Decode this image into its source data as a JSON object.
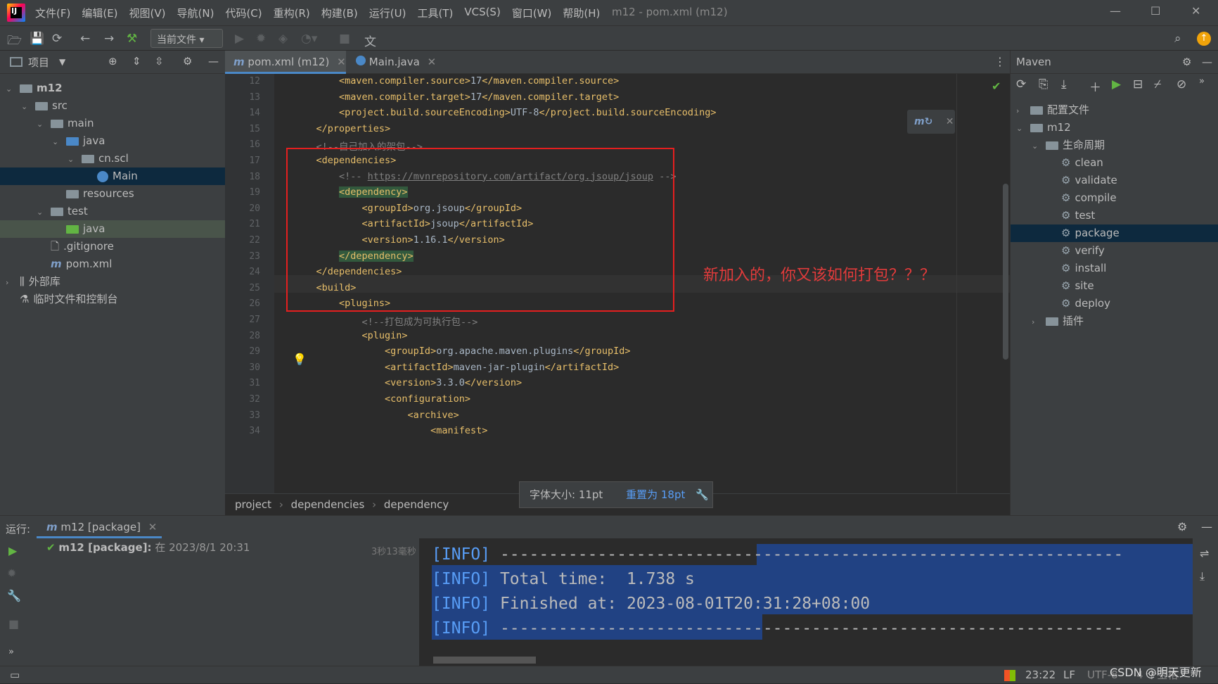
{
  "menubar": {
    "items": [
      "文件(F)",
      "编辑(E)",
      "视图(V)",
      "导航(N)",
      "代码(C)",
      "重构(R)",
      "构建(B)",
      "运行(U)",
      "工具(T)",
      "VCS(S)",
      "窗口(W)",
      "帮助(H)"
    ],
    "title": "m12 - pom.xml (m12)"
  },
  "toolbar": {
    "run_config": "当前文件"
  },
  "project": {
    "header": "项目",
    "tree": [
      {
        "label": "m12",
        "depth": 0,
        "kind": "module",
        "chev": "open"
      },
      {
        "label": "src",
        "depth": 1,
        "kind": "folder",
        "chev": "open"
      },
      {
        "label": "main",
        "depth": 2,
        "kind": "folder",
        "chev": "open"
      },
      {
        "label": "java",
        "depth": 3,
        "kind": "folder-blue",
        "chev": "open"
      },
      {
        "label": "cn.scl",
        "depth": 4,
        "kind": "package",
        "chev": "open"
      },
      {
        "label": "Main",
        "depth": 5,
        "kind": "class",
        "chev": "",
        "selected": true
      },
      {
        "label": "resources",
        "depth": 3,
        "kind": "folder",
        "chev": ""
      },
      {
        "label": "test",
        "depth": 2,
        "kind": "folder",
        "chev": "open"
      },
      {
        "label": "java",
        "depth": 3,
        "kind": "folder-green",
        "chev": "",
        "highlight": true
      },
      {
        "label": ".gitignore",
        "depth": 2,
        "kind": "file",
        "chev": ""
      },
      {
        "label": "pom.xml",
        "depth": 2,
        "kind": "maven",
        "chev": ""
      },
      {
        "label": "外部库",
        "depth": 0,
        "kind": "lib",
        "chev": "closed"
      },
      {
        "label": "临时文件和控制台",
        "depth": 0,
        "kind": "scratch",
        "chev": ""
      }
    ]
  },
  "tabs": [
    {
      "label": "pom.xml (m12)",
      "active": true
    },
    {
      "label": "Main.java",
      "active": false
    }
  ],
  "editor": {
    "lines": [
      {
        "n": "12",
        "code": "        <maven.compiler.source>17</maven.compiler.source>"
      },
      {
        "n": "13",
        "code": "        <maven.compiler.target>17</maven.compiler.target>"
      },
      {
        "n": "14",
        "code": "        <project.build.sourceEncoding>UTF-8</project.build.sourceEncoding>"
      },
      {
        "n": "15",
        "code": "    </properties>"
      },
      {
        "n": "16",
        "code": "    <!--自己加入的架包-->"
      },
      {
        "n": "17",
        "code": "    <dependencies>"
      },
      {
        "n": "18",
        "code": "        <!-- https://mvnrepository.com/artifact/org.jsoup/jsoup -->"
      },
      {
        "n": "19",
        "code": "        <dependency>"
      },
      {
        "n": "20",
        "code": "            <groupId>org.jsoup</groupId>"
      },
      {
        "n": "21",
        "code": "            <artifactId>jsoup</artifactId>"
      },
      {
        "n": "22",
        "code": "            <version>1.16.1</version>"
      },
      {
        "n": "23",
        "code": "        </dependency>"
      },
      {
        "n": "24",
        "code": "    </dependencies>"
      },
      {
        "n": "25",
        "code": "    <build>"
      },
      {
        "n": "26",
        "code": "        <plugins>"
      },
      {
        "n": "27",
        "code": "            <!--打包成为可执行包-->"
      },
      {
        "n": "28",
        "code": "            <plugin>"
      },
      {
        "n": "29",
        "code": "                <groupId>org.apache.maven.plugins</groupId>"
      },
      {
        "n": "30",
        "code": "                <artifactId>maven-jar-plugin</artifactId>"
      },
      {
        "n": "31",
        "code": "                <version>3.3.0</version>"
      },
      {
        "n": "32",
        "code": "                <configuration>"
      },
      {
        "n": "33",
        "code": "                    <archive>"
      },
      {
        "n": "34",
        "code": "                        <manifest>"
      }
    ],
    "annotation": "新加入的，你又该如何打包？？？"
  },
  "breadcrumb": [
    "project",
    "dependencies",
    "dependency"
  ],
  "font_popup": {
    "label": "字体大小: 11pt",
    "reset": "重置为 18pt"
  },
  "maven": {
    "header": "Maven",
    "tree": [
      {
        "label": "配置文件",
        "depth": 0,
        "chev": "closed",
        "kind": "profiles"
      },
      {
        "label": "m12",
        "depth": 0,
        "chev": "open",
        "kind": "module"
      },
      {
        "label": "生命周期",
        "depth": 1,
        "chev": "open",
        "kind": "lifecycle"
      },
      {
        "label": "clean",
        "depth": 2,
        "kind": "goal"
      },
      {
        "label": "validate",
        "depth": 2,
        "kind": "goal"
      },
      {
        "label": "compile",
        "depth": 2,
        "kind": "goal"
      },
      {
        "label": "test",
        "depth": 2,
        "kind": "goal"
      },
      {
        "label": "package",
        "depth": 2,
        "kind": "goal",
        "selected": true
      },
      {
        "label": "verify",
        "depth": 2,
        "kind": "goal"
      },
      {
        "label": "install",
        "depth": 2,
        "kind": "goal"
      },
      {
        "label": "site",
        "depth": 2,
        "kind": "goal"
      },
      {
        "label": "deploy",
        "depth": 2,
        "kind": "goal"
      },
      {
        "label": "插件",
        "depth": 1,
        "chev": "closed",
        "kind": "plugins"
      }
    ]
  },
  "run": {
    "label": "运行:",
    "tab": "m12 [package]",
    "task_name": "m12 [package]:",
    "task_time": "在 2023/8/1 20:31",
    "duration": "3秒13毫秒",
    "console": [
      {
        "tag": "[INFO]",
        "text": " ----------------------------------------------------------------"
      },
      {
        "tag": "[INFO]",
        "text": " Total time:  1.738 s"
      },
      {
        "tag": "[INFO]",
        "text": " Finished at: 2023-08-01T20:31:28+08:00"
      },
      {
        "tag": "[INFO]",
        "text": " ----------------------------------------------------------------"
      }
    ]
  },
  "status": {
    "time": "23:22",
    "eol": "LF",
    "encoding": "UTF-8",
    "indent": "4 个空格",
    "watermark": "CSDN @明天更新"
  }
}
